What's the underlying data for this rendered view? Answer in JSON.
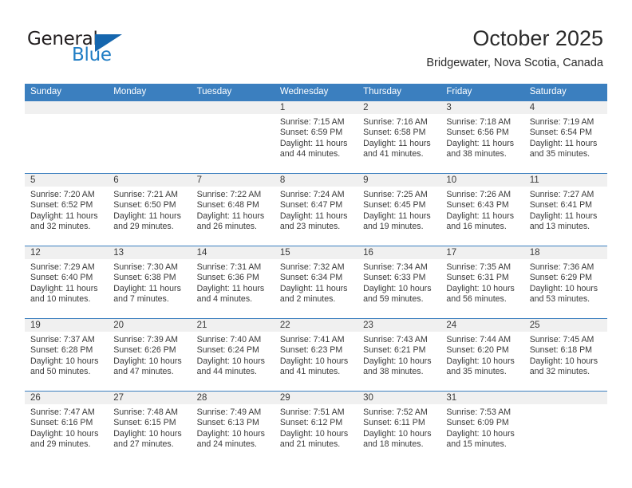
{
  "logo": {
    "word_top": "General",
    "word_bottom": "Blue",
    "triangle_color": "#1566ae",
    "blue_color": "#1f7dc4"
  },
  "header": {
    "title": "October 2025",
    "subtitle": "Bridgewater, Nova Scotia, Canada"
  },
  "theme": {
    "header_blue": "#3b7fbf",
    "daynum_gray": "#f0f0f0",
    "text": "#3a3a3a"
  },
  "weekdays": [
    "Sunday",
    "Monday",
    "Tuesday",
    "Wednesday",
    "Thursday",
    "Friday",
    "Saturday"
  ],
  "labels": {
    "sunrise": "Sunrise:",
    "sunset": "Sunset:",
    "daylight": "Daylight:"
  },
  "weeks": [
    [
      {
        "day": "",
        "sunrise": "",
        "sunset": "",
        "daylight1": "",
        "daylight2": ""
      },
      {
        "day": "",
        "sunrise": "",
        "sunset": "",
        "daylight1": "",
        "daylight2": ""
      },
      {
        "day": "",
        "sunrise": "",
        "sunset": "",
        "daylight1": "",
        "daylight2": ""
      },
      {
        "day": "1",
        "sunrise": "Sunrise: 7:15 AM",
        "sunset": "Sunset: 6:59 PM",
        "daylight1": "Daylight: 11 hours",
        "daylight2": "and 44 minutes."
      },
      {
        "day": "2",
        "sunrise": "Sunrise: 7:16 AM",
        "sunset": "Sunset: 6:58 PM",
        "daylight1": "Daylight: 11 hours",
        "daylight2": "and 41 minutes."
      },
      {
        "day": "3",
        "sunrise": "Sunrise: 7:18 AM",
        "sunset": "Sunset: 6:56 PM",
        "daylight1": "Daylight: 11 hours",
        "daylight2": "and 38 minutes."
      },
      {
        "day": "4",
        "sunrise": "Sunrise: 7:19 AM",
        "sunset": "Sunset: 6:54 PM",
        "daylight1": "Daylight: 11 hours",
        "daylight2": "and 35 minutes."
      }
    ],
    [
      {
        "day": "5",
        "sunrise": "Sunrise: 7:20 AM",
        "sunset": "Sunset: 6:52 PM",
        "daylight1": "Daylight: 11 hours",
        "daylight2": "and 32 minutes."
      },
      {
        "day": "6",
        "sunrise": "Sunrise: 7:21 AM",
        "sunset": "Sunset: 6:50 PM",
        "daylight1": "Daylight: 11 hours",
        "daylight2": "and 29 minutes."
      },
      {
        "day": "7",
        "sunrise": "Sunrise: 7:22 AM",
        "sunset": "Sunset: 6:48 PM",
        "daylight1": "Daylight: 11 hours",
        "daylight2": "and 26 minutes."
      },
      {
        "day": "8",
        "sunrise": "Sunrise: 7:24 AM",
        "sunset": "Sunset: 6:47 PM",
        "daylight1": "Daylight: 11 hours",
        "daylight2": "and 23 minutes."
      },
      {
        "day": "9",
        "sunrise": "Sunrise: 7:25 AM",
        "sunset": "Sunset: 6:45 PM",
        "daylight1": "Daylight: 11 hours",
        "daylight2": "and 19 minutes."
      },
      {
        "day": "10",
        "sunrise": "Sunrise: 7:26 AM",
        "sunset": "Sunset: 6:43 PM",
        "daylight1": "Daylight: 11 hours",
        "daylight2": "and 16 minutes."
      },
      {
        "day": "11",
        "sunrise": "Sunrise: 7:27 AM",
        "sunset": "Sunset: 6:41 PM",
        "daylight1": "Daylight: 11 hours",
        "daylight2": "and 13 minutes."
      }
    ],
    [
      {
        "day": "12",
        "sunrise": "Sunrise: 7:29 AM",
        "sunset": "Sunset: 6:40 PM",
        "daylight1": "Daylight: 11 hours",
        "daylight2": "and 10 minutes."
      },
      {
        "day": "13",
        "sunrise": "Sunrise: 7:30 AM",
        "sunset": "Sunset: 6:38 PM",
        "daylight1": "Daylight: 11 hours",
        "daylight2": "and 7 minutes."
      },
      {
        "day": "14",
        "sunrise": "Sunrise: 7:31 AM",
        "sunset": "Sunset: 6:36 PM",
        "daylight1": "Daylight: 11 hours",
        "daylight2": "and 4 minutes."
      },
      {
        "day": "15",
        "sunrise": "Sunrise: 7:32 AM",
        "sunset": "Sunset: 6:34 PM",
        "daylight1": "Daylight: 11 hours",
        "daylight2": "and 2 minutes."
      },
      {
        "day": "16",
        "sunrise": "Sunrise: 7:34 AM",
        "sunset": "Sunset: 6:33 PM",
        "daylight1": "Daylight: 10 hours",
        "daylight2": "and 59 minutes."
      },
      {
        "day": "17",
        "sunrise": "Sunrise: 7:35 AM",
        "sunset": "Sunset: 6:31 PM",
        "daylight1": "Daylight: 10 hours",
        "daylight2": "and 56 minutes."
      },
      {
        "day": "18",
        "sunrise": "Sunrise: 7:36 AM",
        "sunset": "Sunset: 6:29 PM",
        "daylight1": "Daylight: 10 hours",
        "daylight2": "and 53 minutes."
      }
    ],
    [
      {
        "day": "19",
        "sunrise": "Sunrise: 7:37 AM",
        "sunset": "Sunset: 6:28 PM",
        "daylight1": "Daylight: 10 hours",
        "daylight2": "and 50 minutes."
      },
      {
        "day": "20",
        "sunrise": "Sunrise: 7:39 AM",
        "sunset": "Sunset: 6:26 PM",
        "daylight1": "Daylight: 10 hours",
        "daylight2": "and 47 minutes."
      },
      {
        "day": "21",
        "sunrise": "Sunrise: 7:40 AM",
        "sunset": "Sunset: 6:24 PM",
        "daylight1": "Daylight: 10 hours",
        "daylight2": "and 44 minutes."
      },
      {
        "day": "22",
        "sunrise": "Sunrise: 7:41 AM",
        "sunset": "Sunset: 6:23 PM",
        "daylight1": "Daylight: 10 hours",
        "daylight2": "and 41 minutes."
      },
      {
        "day": "23",
        "sunrise": "Sunrise: 7:43 AM",
        "sunset": "Sunset: 6:21 PM",
        "daylight1": "Daylight: 10 hours",
        "daylight2": "and 38 minutes."
      },
      {
        "day": "24",
        "sunrise": "Sunrise: 7:44 AM",
        "sunset": "Sunset: 6:20 PM",
        "daylight1": "Daylight: 10 hours",
        "daylight2": "and 35 minutes."
      },
      {
        "day": "25",
        "sunrise": "Sunrise: 7:45 AM",
        "sunset": "Sunset: 6:18 PM",
        "daylight1": "Daylight: 10 hours",
        "daylight2": "and 32 minutes."
      }
    ],
    [
      {
        "day": "26",
        "sunrise": "Sunrise: 7:47 AM",
        "sunset": "Sunset: 6:16 PM",
        "daylight1": "Daylight: 10 hours",
        "daylight2": "and 29 minutes."
      },
      {
        "day": "27",
        "sunrise": "Sunrise: 7:48 AM",
        "sunset": "Sunset: 6:15 PM",
        "daylight1": "Daylight: 10 hours",
        "daylight2": "and 27 minutes."
      },
      {
        "day": "28",
        "sunrise": "Sunrise: 7:49 AM",
        "sunset": "Sunset: 6:13 PM",
        "daylight1": "Daylight: 10 hours",
        "daylight2": "and 24 minutes."
      },
      {
        "day": "29",
        "sunrise": "Sunrise: 7:51 AM",
        "sunset": "Sunset: 6:12 PM",
        "daylight1": "Daylight: 10 hours",
        "daylight2": "and 21 minutes."
      },
      {
        "day": "30",
        "sunrise": "Sunrise: 7:52 AM",
        "sunset": "Sunset: 6:11 PM",
        "daylight1": "Daylight: 10 hours",
        "daylight2": "and 18 minutes."
      },
      {
        "day": "31",
        "sunrise": "Sunrise: 7:53 AM",
        "sunset": "Sunset: 6:09 PM",
        "daylight1": "Daylight: 10 hours",
        "daylight2": "and 15 minutes."
      },
      {
        "day": "",
        "sunrise": "",
        "sunset": "",
        "daylight1": "",
        "daylight2": ""
      }
    ]
  ]
}
